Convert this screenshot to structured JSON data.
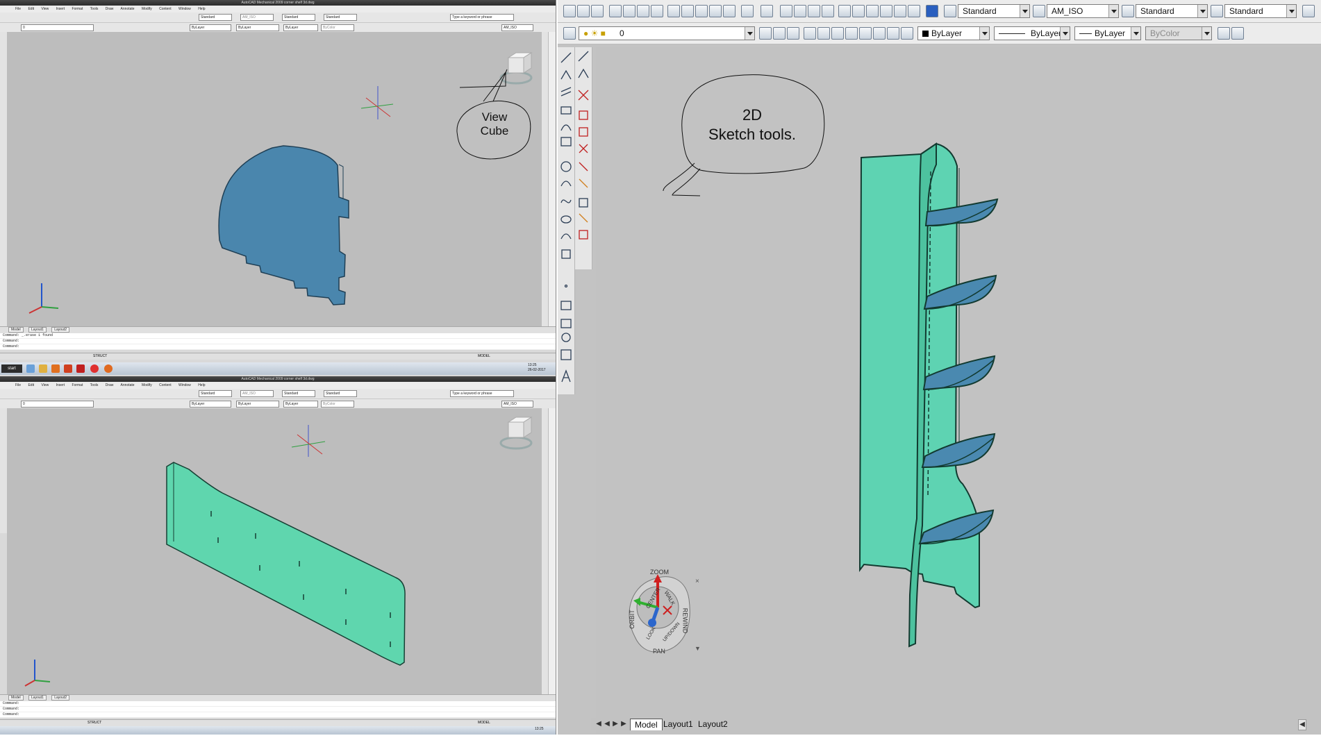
{
  "top_window": {
    "title": "AutoCAD Mechanical 2009  corner shelf 3d.dwg",
    "search_placeholder": "Type a keyword or phrase",
    "menus": [
      "File",
      "Edit",
      "View",
      "Insert",
      "Format",
      "Tools",
      "Draw",
      "Annotate",
      "Modify",
      "Content",
      "Window",
      "Help"
    ],
    "text_style": "Standard",
    "dim_style": "AM_ISO",
    "table_style": "Standard",
    "multileader_style": "Standard",
    "layer": "0",
    "color": "ByLayer",
    "linetype": "ByLayer",
    "lineweight": "ByLayer",
    "plotstyle": "ByColor",
    "tabs": [
      "Model",
      "Layout1",
      "Layout2"
    ],
    "command_lines": [
      "Command: _.erase 1 found",
      "Command:",
      "Command:"
    ],
    "status_right": "MODEL",
    "struct_label": "STRUCT",
    "taskbar_start": "start",
    "clock_time": "13:25",
    "clock_date": "26-02-2017",
    "callout": {
      "line1": "View",
      "line2": "Cube"
    },
    "part_color": "#4a86ad"
  },
  "bottom_window": {
    "title": "AutoCAD Mechanical 2009  corner shelf 3d.dwg",
    "search_placeholder": "Type a keyword or phrase",
    "menus": [
      "File",
      "Edit",
      "View",
      "Insert",
      "Format",
      "Tools",
      "Draw",
      "Annotate",
      "Modify",
      "Content",
      "Window",
      "Help"
    ],
    "text_style": "Standard",
    "dim_style": "AM_ISO",
    "table_style": "Standard",
    "multileader_style": "Standard",
    "layer": "0",
    "color": "ByLayer",
    "linetype": "ByLayer",
    "lineweight": "ByLayer",
    "plotstyle": "ByColor",
    "tabs": [
      "Model",
      "Layout1",
      "Layout2"
    ],
    "command_lines": [
      "Command:",
      "Command:",
      "Command:"
    ],
    "status_right": "MODEL",
    "struct_label": "STRUCT",
    "clock_time": "13:25",
    "part_color": "#5fd6ae"
  },
  "main_window": {
    "toolbar1": {
      "text_style": "Standard",
      "dim_style": "AM_ISO",
      "table_style": "Standard",
      "multileader_style": "Standard"
    },
    "toolbar2": {
      "layer": "0",
      "color": "ByLayer",
      "linetype": "ByLayer",
      "lineweight": "ByLayer",
      "plotstyle": "ByColor"
    },
    "callout": {
      "line1": "2D",
      "line2": "Sketch tools."
    },
    "steering_wheel": {
      "labels": [
        "ZOOM",
        "CENTER",
        "WALK",
        "REWIND",
        "ORBIT",
        "UP/DOWN",
        "PAN",
        "LOOK"
      ]
    },
    "tabs": [
      "Model",
      "Layout1",
      "Layout2"
    ],
    "active_tab": "Model",
    "shelf_side_color": "#5ed3b2",
    "shelf_color": "#4a89b0"
  }
}
